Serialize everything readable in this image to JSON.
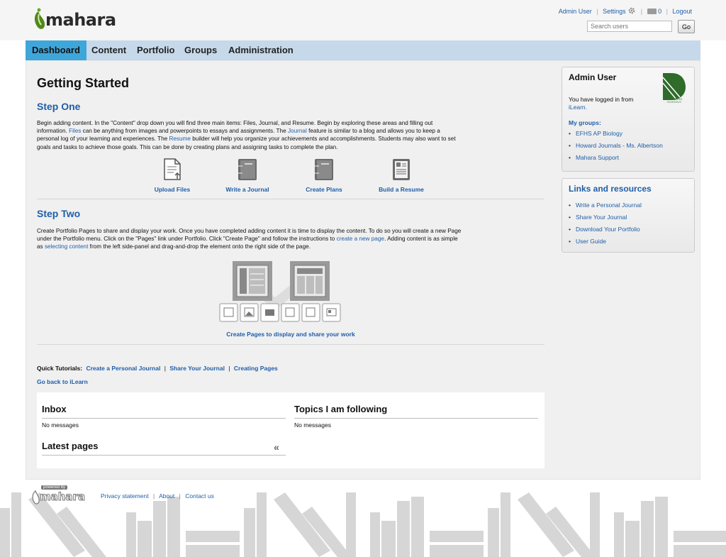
{
  "header": {
    "brand": "mahara",
    "user_link": "Admin User",
    "settings_label": "Settings",
    "inbox_count": "0",
    "logout_label": "Logout",
    "search_placeholder": "Search users",
    "search_button": "Go"
  },
  "nav": {
    "tabs": [
      {
        "label": "Dashboard",
        "active": true
      },
      {
        "label": "Content"
      },
      {
        "label": "Portfolio"
      },
      {
        "label": "Groups"
      },
      {
        "label": "Administration"
      }
    ]
  },
  "main": {
    "title": "Getting Started",
    "step_one": {
      "heading": "Step One",
      "p1": "Begin adding content.  In the \"Content\" drop down you will find three main items: Files, Journal, and Resume.  Begin by exploring these areas and filling out",
      "p2a": "information.  ",
      "p2_files": "Files",
      "p2b": " can be anything from images and powerpoints to essays and assignments.  The ",
      "p2_journal": "Journal",
      "p2c": " feature is similar to a blog and allows you to keep a",
      "p3a": "personal log of your learning and experiences.  The ",
      "p3_resume": "Resume",
      "p3b": " builder will help you organize your achievements and accomplishments. Students may also want to set",
      "p4": "goals and tasks to achieve those goals.  This can be done by creating plans and assigning tasks to complete the plan."
    },
    "tools": [
      {
        "label": "Upload Files",
        "icon": "file-upload-icon"
      },
      {
        "label": "Write a Journal",
        "icon": "journal-icon"
      },
      {
        "label": "Create Plans",
        "icon": "plans-icon"
      },
      {
        "label": "Build a Resume",
        "icon": "resume-icon"
      }
    ],
    "step_two": {
      "heading": "Step Two",
      "p1": "Create Portfolio Pages to share and display your work.  Once you have completed adding content it is time to display the content. To do so you will create a new Page",
      "p2a": "under the Portfolio menu.  Click on the \"Pages\" link under Portfolio.  Click \"Create Page\" and follow the instructions to ",
      "p2_link": "create a new page",
      "p2b": ".  Adding content is as simple",
      "p3a": "as ",
      "p3_link": "selecting content",
      "p3b": " from the left side-panel and drag-and-drop the element onto the right side of the page."
    },
    "pages_caption": "Create Pages to display and share your work",
    "quick_tutorials_label": "Quick Tutorials:",
    "tutorials": [
      "Create a Personal Journal",
      "Share Your Journal",
      "Creating Pages"
    ],
    "go_back": "Go back to iLearn"
  },
  "panels": {
    "inbox_title": "Inbox",
    "inbox_empty": "No messages",
    "topics_title": "Topics I am following",
    "topics_empty": "No messages",
    "latest_title": "Latest pages"
  },
  "sidebar": {
    "user_title": "Admin User",
    "login_text": "You have logged in from",
    "login_source": "iLearn.",
    "school_logo_text": "DEARBORN SCHOOLS",
    "groups_label": "My groups:",
    "groups": [
      "EFHS AP Biology",
      "Howard Journals - Ms. Albertson",
      "Mahara Support"
    ],
    "links_title": "Links and resources",
    "links": [
      "Write a Personal Journal",
      "Share Your Journal",
      "Download Your Portfolio",
      "User Guide"
    ]
  },
  "footer": {
    "powered_by": "powered by",
    "brand": "mahara",
    "links": [
      "Privacy statement",
      "About",
      "Contact us"
    ]
  },
  "colors": {
    "accent": "#3fa6d9",
    "nav_bg": "#c6d9ea",
    "link": "#1f5ea8",
    "logo_green": "#4e8a1a"
  }
}
